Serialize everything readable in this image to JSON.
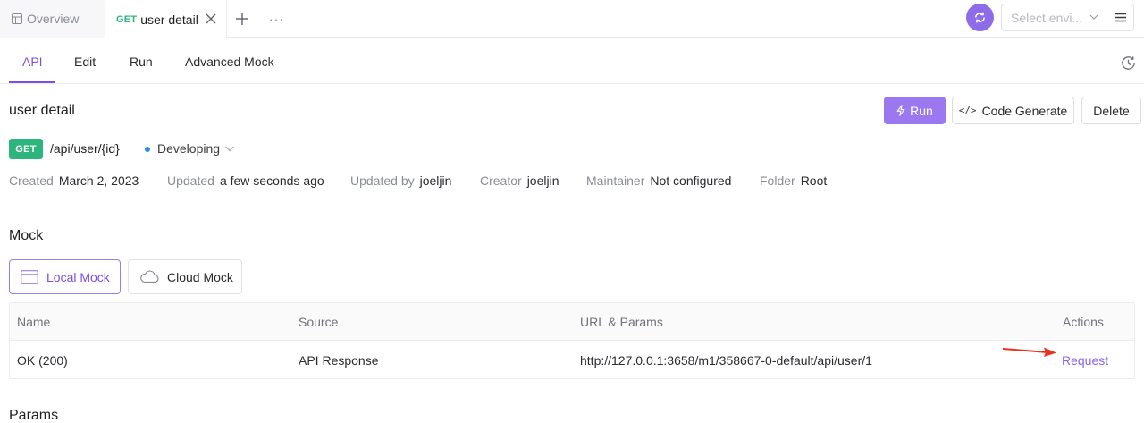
{
  "tabs": {
    "overview_label": "Overview",
    "active_method": "GET",
    "active_label": "user detail",
    "more_label": "···"
  },
  "env": {
    "placeholder": "Select envi..."
  },
  "subtabs": [
    {
      "label": "API",
      "active": true
    },
    {
      "label": "Edit",
      "active": false
    },
    {
      "label": "Run",
      "active": false
    },
    {
      "label": "Advanced Mock",
      "active": false
    }
  ],
  "header": {
    "title": "user detail",
    "run_label": "Run",
    "code_label": "Code Generate",
    "delete_label": "Delete"
  },
  "endpoint": {
    "method": "GET",
    "path": "/api/user/{id}",
    "status": "Developing",
    "status_color": "#2b8cf0"
  },
  "meta": [
    {
      "label": "Created",
      "value": "March 2, 2023"
    },
    {
      "label": "Updated",
      "value": "a few seconds ago"
    },
    {
      "label": "Updated by",
      "value": "joeljin"
    },
    {
      "label": "Creator",
      "value": "joeljin"
    },
    {
      "label": "Maintainer",
      "value": "Not configured"
    },
    {
      "label": "Folder",
      "value": "Root"
    }
  ],
  "mock": {
    "title": "Mock",
    "local_label": "Local Mock",
    "cloud_label": "Cloud Mock",
    "columns": [
      "Name",
      "Source",
      "URL & Params",
      "Actions"
    ],
    "rows": [
      {
        "name": "OK (200)",
        "source": "API Response",
        "url": "http://127.0.0.1:3658/m1/358667-0-default/api/user/1",
        "action": "Request"
      }
    ]
  },
  "params": {
    "title": "Params"
  },
  "colors": {
    "accent": "#7b4fe0",
    "get_green": "#2cb67d",
    "annotation_red": "#e8321e"
  }
}
